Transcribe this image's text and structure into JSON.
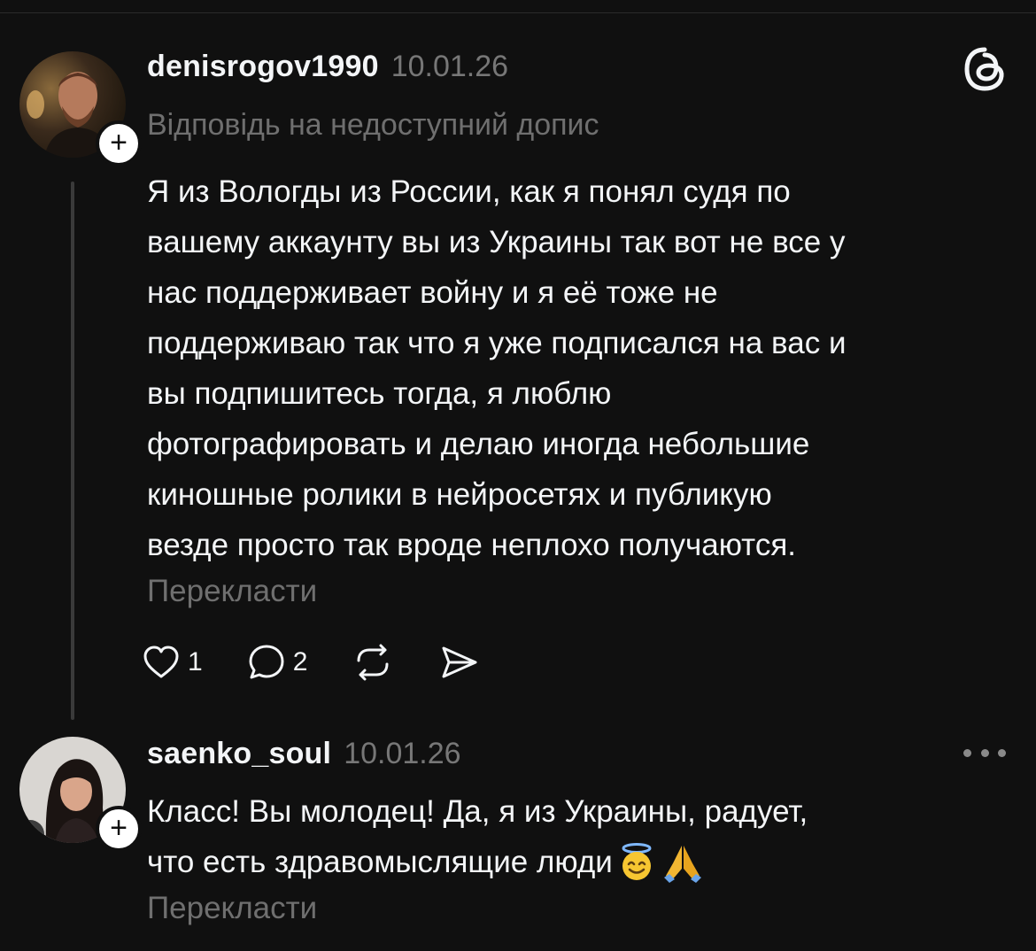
{
  "post1": {
    "username": "denisrogov1990",
    "date": "10.01.26",
    "reply_to": "Відповідь на недоступний допис",
    "lines": [
      "Я из Вологды из России, как я понял судя по",
      "вашему аккаунту вы из Украины так вот не все у",
      "нас поддерживает войну и я её тоже не",
      "поддерживаю так что я уже подписался на вас и",
      "вы подпишитесь тогда, я люблю",
      "фотографировать и делаю иногда небольшие",
      "киношные ролики в нейросетях и публикую",
      "везде просто так вроде неплохо получаются."
    ],
    "translate_label": "Перекласти",
    "like_count": "1",
    "reply_count": "2",
    "follow_symbol": "+"
  },
  "post2": {
    "username": "saenko_soul",
    "date": "10.01.26",
    "lines": [
      "Класс! Вы молодец! Да, я из Украины, радует,",
      "что есть здравомыслящие люди"
    ],
    "emojis": [
      "smiling-face-with-halo",
      "folded-hands"
    ],
    "translate_label": "Перекласти",
    "follow_symbol": "+"
  },
  "icons": {
    "app_logo": "threads-logo-icon",
    "like": "heart-icon",
    "reply": "comment-bubble-icon",
    "repost": "repost-icon",
    "share": "send-icon",
    "more": "more-dots-icon"
  },
  "colors": {
    "background": "#101010",
    "text_primary": "#f3f5f7",
    "text_secondary": "#777777",
    "thread_line": "#3a3a3a"
  }
}
